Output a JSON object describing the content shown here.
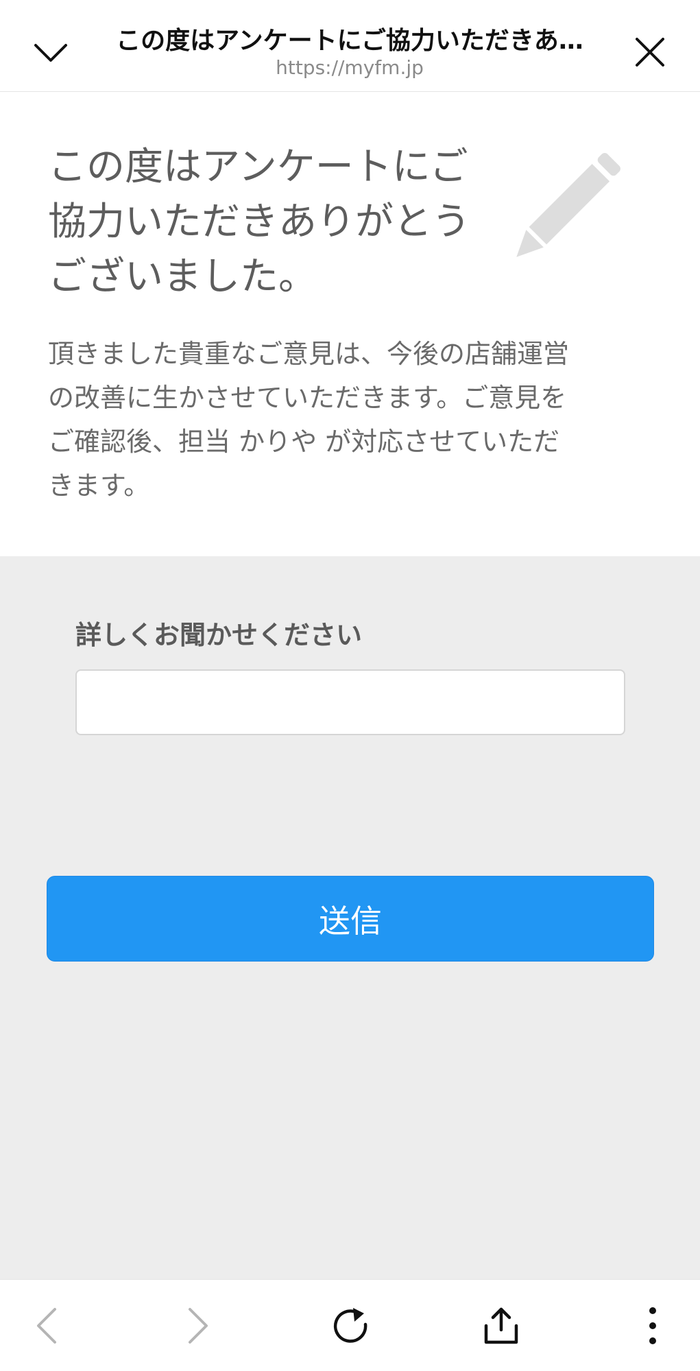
{
  "browser": {
    "title": "この度はアンケートにご協力いただきあ…",
    "url": "https://myfm.jp"
  },
  "intro": {
    "heading_lines": [
      "この度はアンケートにご",
      "協力いただきありがとう",
      "ございました。"
    ],
    "message_lines": [
      "頂きました貴重なご意見は、今後の店舗運営",
      "の改善に生かさせていただきます。ご意見を",
      "ご確認後、担当 かりや が対応させていただ",
      "きます。"
    ]
  },
  "form": {
    "detail_label": "詳しくお聞かせください",
    "detail_value": "",
    "detail_placeholder": "",
    "submit_label": "送信"
  },
  "icons": {
    "collapse": "chevron-down-icon",
    "close": "close-icon",
    "decoration": "pencil-icon",
    "back": "chevron-left-icon",
    "forward": "chevron-right-icon",
    "reload": "reload-icon",
    "share": "share-icon",
    "more": "more-vertical-icon"
  },
  "colors": {
    "accent": "#2196f3",
    "page_background": "#ededed",
    "intro_background": "#ffffff",
    "disabled_icon": "#b5b5b5"
  }
}
